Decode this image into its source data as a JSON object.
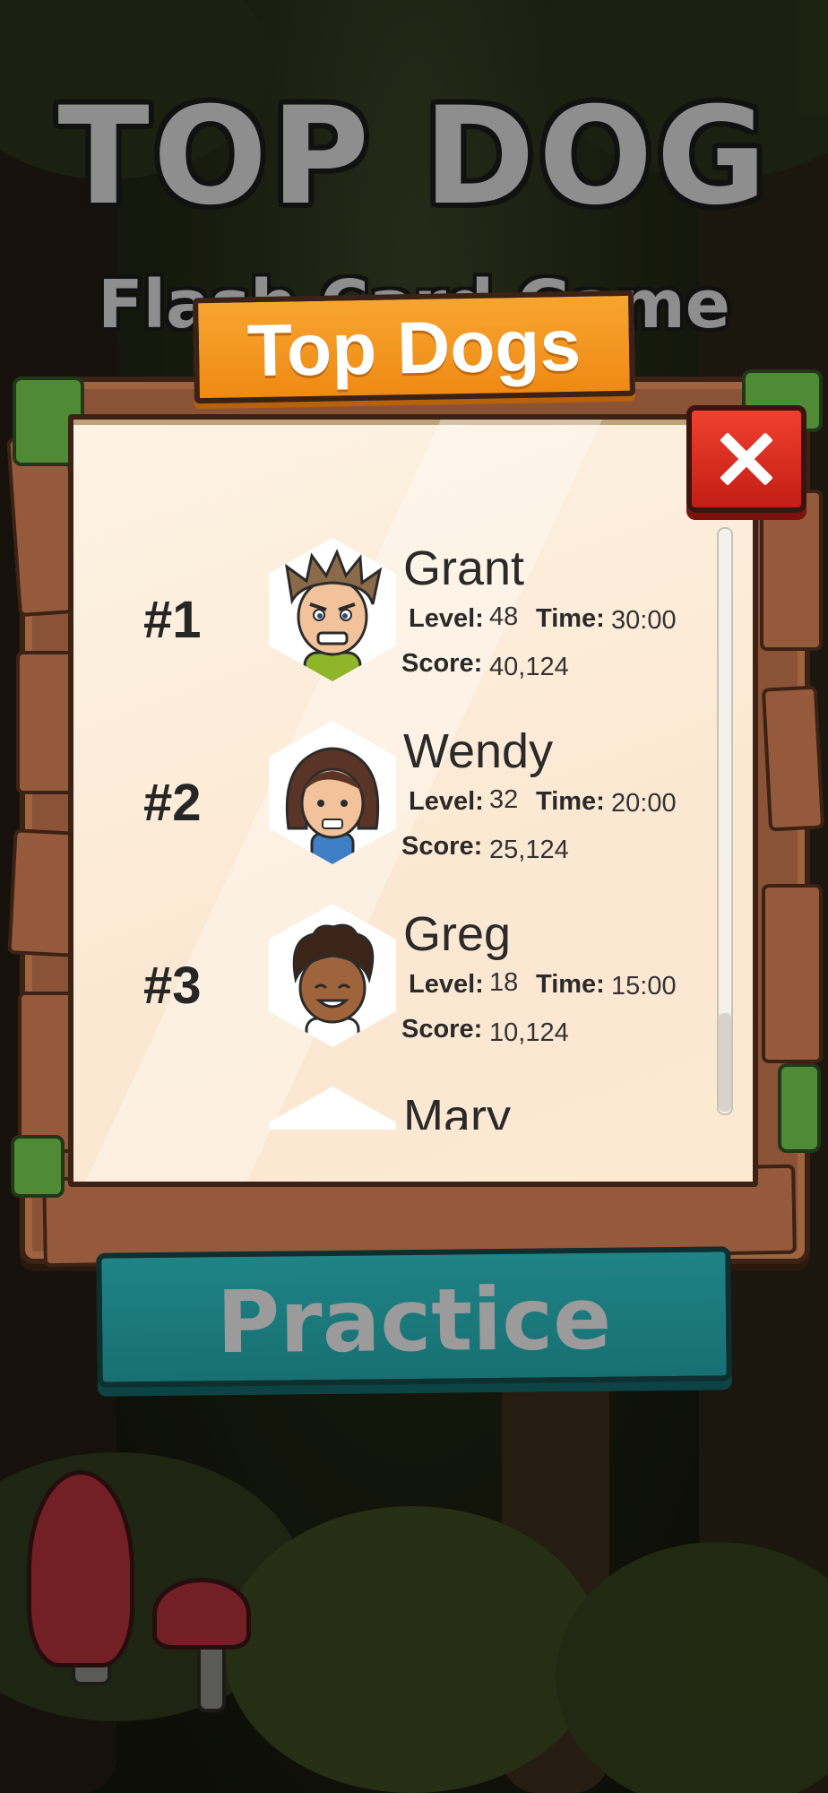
{
  "game": {
    "title": "TOP DOG",
    "subtitle": "Flash Card Game"
  },
  "modal": {
    "title": "Top Dogs",
    "close_icon": "close-x-icon"
  },
  "leaderboard": [
    {
      "rank": "#1",
      "name": "Grant",
      "level_label": "Level:",
      "level": "48",
      "time_label": "Time:",
      "time": "30:00",
      "score_label": "Score:",
      "score": "40,124",
      "avatar": "boy-spiky-hair-avatar"
    },
    {
      "rank": "#2",
      "name": "Wendy",
      "level_label": "Level:",
      "level": "32",
      "time_label": "Time:",
      "time": "20:00",
      "score_label": "Score:",
      "score": "25,124",
      "avatar": "girl-brown-hair-avatar"
    },
    {
      "rank": "#3",
      "name": "Greg",
      "level_label": "Level:",
      "level": "18",
      "time_label": "Time:",
      "time": "15:00",
      "score_label": "Score:",
      "score": "10,124",
      "avatar": "boy-curly-hair-avatar"
    },
    {
      "rank": "",
      "name": "Mary",
      "avatar": "partial-avatar"
    }
  ],
  "practice_button": {
    "label": "Practice"
  },
  "colors": {
    "banner": "#ef8a14",
    "close": "#d9281b",
    "practice": "#1f8386",
    "wood": "#8a5237",
    "paper": "#fbe8d2"
  }
}
